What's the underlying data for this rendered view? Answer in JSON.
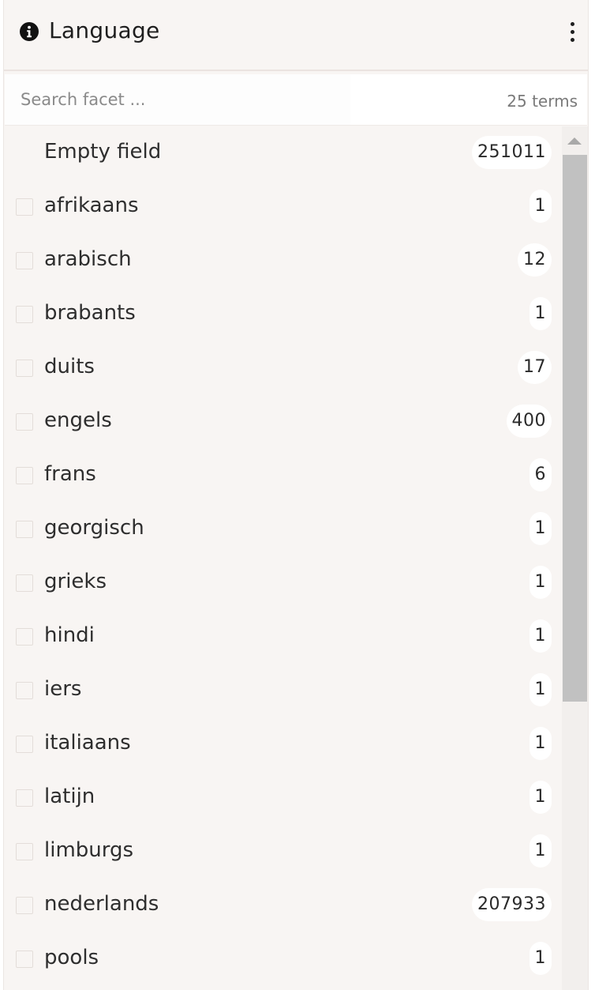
{
  "facet": {
    "title": "Language",
    "info_icon": "info-circle-icon",
    "menu_icon": "more-vertical-icon"
  },
  "search": {
    "placeholder": "Search facet ...",
    "value": "",
    "terms_count": "25 terms"
  },
  "items": [
    {
      "label": "Empty field",
      "count": "251011",
      "has_checkbox": false
    },
    {
      "label": "afrikaans",
      "count": "1",
      "has_checkbox": true
    },
    {
      "label": "arabisch",
      "count": "12",
      "has_checkbox": true
    },
    {
      "label": "brabants",
      "count": "1",
      "has_checkbox": true
    },
    {
      "label": "duits",
      "count": "17",
      "has_checkbox": true
    },
    {
      "label": "engels",
      "count": "400",
      "has_checkbox": true
    },
    {
      "label": "frans",
      "count": "6",
      "has_checkbox": true
    },
    {
      "label": "georgisch",
      "count": "1",
      "has_checkbox": true
    },
    {
      "label": "grieks",
      "count": "1",
      "has_checkbox": true
    },
    {
      "label": "hindi",
      "count": "1",
      "has_checkbox": true
    },
    {
      "label": "iers",
      "count": "1",
      "has_checkbox": true
    },
    {
      "label": "italiaans",
      "count": "1",
      "has_checkbox": true
    },
    {
      "label": "latijn",
      "count": "1",
      "has_checkbox": true
    },
    {
      "label": "limburgs",
      "count": "1",
      "has_checkbox": true
    },
    {
      "label": "nederlands",
      "count": "207933",
      "has_checkbox": true
    },
    {
      "label": "pools",
      "count": "1",
      "has_checkbox": true
    }
  ],
  "colors": {
    "panel_bg": "#f8f5f3",
    "badge_bg": "#ffffff",
    "text": "#2e2e2e",
    "scroll_thumb": "#c1c1c1"
  }
}
